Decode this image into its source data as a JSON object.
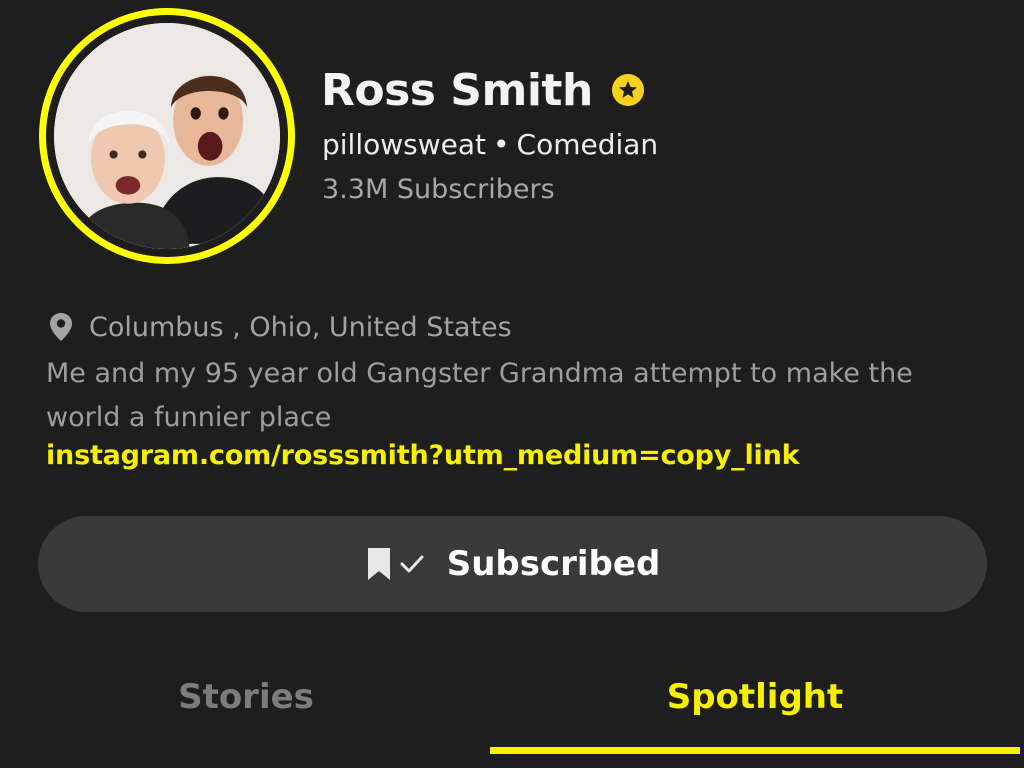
{
  "profile": {
    "display_name": "Ross Smith",
    "verified_icon": "star-badge-icon",
    "username": "pillowsweat",
    "separator": "•",
    "category": "Comedian",
    "subscribers": "3.3M Subscribers",
    "avatar_icon": "profile-photo"
  },
  "bio": {
    "location_icon": "location-pin-icon",
    "location": "Columbus , Ohio, United States",
    "description": "Me and my 95 year old Gangster Grandma attempt to make the world a funnier place",
    "link": "instagram.com/rosssmith?utm_medium=copy_link"
  },
  "subscribe_button": {
    "label": "Subscribed",
    "icons": [
      "bookmark-icon",
      "checkmark-icon"
    ]
  },
  "tabs": [
    {
      "label": "Stories",
      "active": false
    },
    {
      "label": "Spotlight",
      "active": true
    }
  ],
  "colors": {
    "background": "#1e1e1e",
    "accent": "#f7f000",
    "button_bg": "#3a3a3a",
    "primary_text": "#f2f2f2",
    "secondary_text": "#a3a3a3",
    "inactive_tab": "#7c7c7c"
  }
}
